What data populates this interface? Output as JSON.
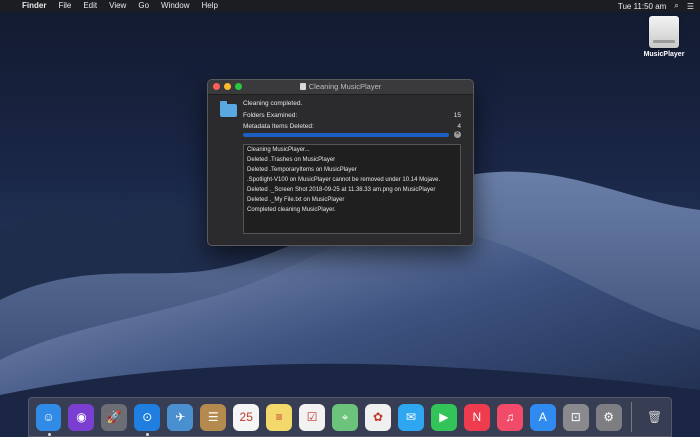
{
  "menubar": {
    "apple": "",
    "app_name": "Finder",
    "items": [
      "File",
      "Edit",
      "View",
      "Go",
      "Window",
      "Help"
    ],
    "clock": "Tue 11:50 am"
  },
  "desktop": {
    "drive_label": "MusicPlayer"
  },
  "window": {
    "title": "Cleaning MusicPlayer",
    "status": "Cleaning completed.",
    "folders_label": "Folders Examined:",
    "folders_value": "15",
    "meta_label": "Metadata Items Deleted:",
    "meta_value": "4",
    "progress": 1.0,
    "log": [
      "Cleaning MusicPlayer...",
      "Deleted .Trashes on MusicPlayer",
      "Deleted .TemporaryItems on MusicPlayer",
      ".Spotlight-V100 on MusicPlayer cannot be removed under 10.14 Mojave.",
      "Deleted ._Screen Shot 2018-09-25 at 11.38.33 am.png on MusicPlayer",
      "Deleted ._My File.txt on MusicPlayer",
      "Completed cleaning MusicPlayer."
    ]
  },
  "dock": {
    "items": [
      {
        "name": "finder",
        "color": "#2f8be6",
        "glyph": "☺",
        "running": true
      },
      {
        "name": "siri",
        "color": "#7a3fd1",
        "glyph": "◉",
        "running": false
      },
      {
        "name": "launchpad",
        "color": "#6d6d75",
        "glyph": "🚀",
        "running": false
      },
      {
        "name": "safari",
        "color": "#1f7fe0",
        "glyph": "⊙",
        "running": true
      },
      {
        "name": "mail-photo",
        "color": "#4a8fcf",
        "glyph": "✈",
        "running": false
      },
      {
        "name": "contacts",
        "color": "#b58a4f",
        "glyph": "☰",
        "running": false
      },
      {
        "name": "calendar",
        "color": "#f5f5f5",
        "glyph": "25",
        "running": false
      },
      {
        "name": "notes",
        "color": "#f3d96b",
        "glyph": "≡",
        "running": false
      },
      {
        "name": "reminders",
        "color": "#f2f2f2",
        "glyph": "☑",
        "running": false
      },
      {
        "name": "maps",
        "color": "#6cc47c",
        "glyph": "⌖",
        "running": false
      },
      {
        "name": "photos",
        "color": "#f0f0f0",
        "glyph": "✿",
        "running": false
      },
      {
        "name": "messages",
        "color": "#2fa7f0",
        "glyph": "✉",
        "running": false
      },
      {
        "name": "facetime",
        "color": "#33c459",
        "glyph": "▶",
        "running": false
      },
      {
        "name": "news",
        "color": "#ef3b4e",
        "glyph": "N",
        "running": false
      },
      {
        "name": "music",
        "color": "#f24b6a",
        "glyph": "♫",
        "running": false
      },
      {
        "name": "app-store",
        "color": "#2f8bf0",
        "glyph": "A",
        "running": false
      },
      {
        "name": "screenshot",
        "color": "#8a8a8e",
        "glyph": "⊡",
        "running": false
      },
      {
        "name": "system-preferences",
        "color": "#7d7d82",
        "glyph": "⚙",
        "running": false
      }
    ],
    "trash_glyph": "🗑"
  }
}
